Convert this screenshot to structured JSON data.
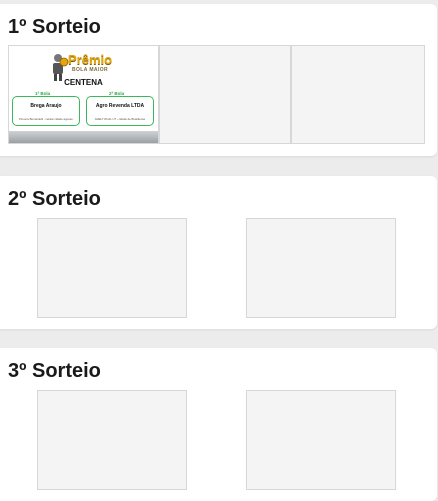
{
  "draws": [
    {
      "title": "1º Sorteio",
      "prize_image": {
        "logo_main": "Prêmio",
        "logo_sub": "BOLA MAIOR",
        "category": "CENTENA",
        "first_ball_label": "1ª Bola",
        "second_ball_label": "2ª Bola",
        "winner_1_name": "Brega Araujo",
        "winner_1_info": "Pinuera Bernardelli - celular cidade agreste",
        "winner_2_name": "Agro Revenda LTDA",
        "winner_2_info": "ADELT RUAL UT - cidade de Brasiliense"
      }
    },
    {
      "title": "2º Sorteio"
    },
    {
      "title": "3º Sorteio"
    }
  ],
  "colors": {
    "page_background": "#ececec",
    "card_background": "#ffffff",
    "placeholder_background": "#f4f4f4",
    "placeholder_border": "#d7d7d7",
    "prize_accent_gold": "#e4a50d",
    "prize_accent_green": "#3bb85a"
  }
}
